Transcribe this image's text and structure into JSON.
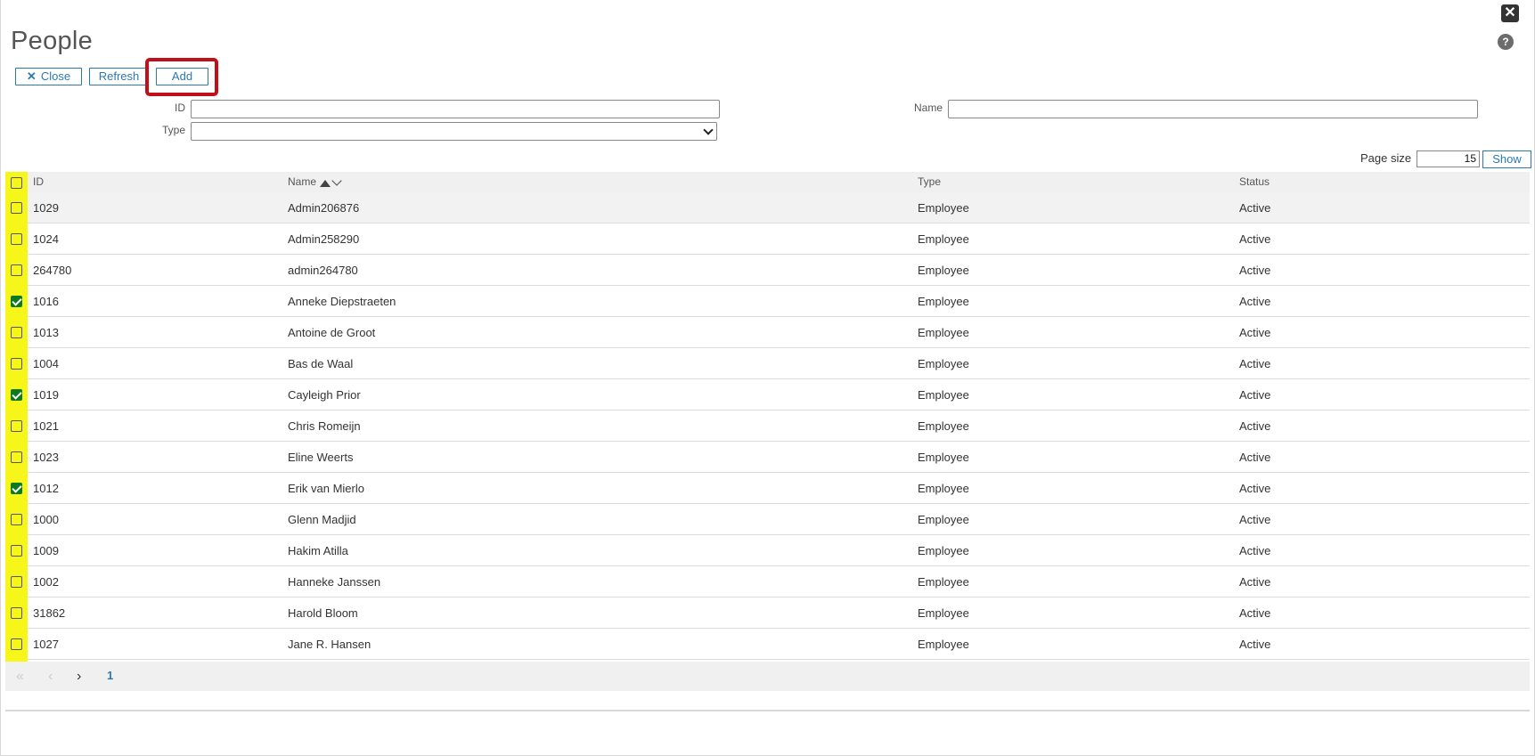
{
  "window": {
    "close_glyph": "✕",
    "help_glyph": "?"
  },
  "page": {
    "title": "People"
  },
  "toolbar": {
    "close_label": "Close",
    "close_icon": "✕",
    "refresh_label": "Refresh",
    "add_label": "Add"
  },
  "filters": {
    "id_label": "ID",
    "id_value": "",
    "name_label": "Name",
    "name_value": "",
    "type_label": "Type",
    "type_value": ""
  },
  "paging": {
    "page_size_label": "Page size",
    "page_size_value": "15",
    "show_label": "Show",
    "current_page": "1",
    "first_glyph": "«",
    "prev_glyph": "‹",
    "next_glyph": "›"
  },
  "grid": {
    "columns": [
      "ID",
      "Name",
      "Type",
      "Status"
    ],
    "sorted_column": "Name",
    "rows": [
      {
        "checked": false,
        "id": "1029",
        "name": "Admin206876",
        "type": "Employee",
        "status": "Active"
      },
      {
        "checked": false,
        "id": "1024",
        "name": "Admin258290",
        "type": "Employee",
        "status": "Active"
      },
      {
        "checked": false,
        "id": "264780",
        "name": "admin264780",
        "type": "Employee",
        "status": "Active"
      },
      {
        "checked": true,
        "id": "1016",
        "name": "Anneke Diepstraeten",
        "type": "Employee",
        "status": "Active"
      },
      {
        "checked": false,
        "id": "1013",
        "name": "Antoine de Groot",
        "type": "Employee",
        "status": "Active"
      },
      {
        "checked": false,
        "id": "1004",
        "name": "Bas de Waal",
        "type": "Employee",
        "status": "Active"
      },
      {
        "checked": true,
        "id": "1019",
        "name": "Cayleigh Prior",
        "type": "Employee",
        "status": "Active"
      },
      {
        "checked": false,
        "id": "1021",
        "name": "Chris Romeijn",
        "type": "Employee",
        "status": "Active"
      },
      {
        "checked": false,
        "id": "1023",
        "name": "Eline Weerts",
        "type": "Employee",
        "status": "Active"
      },
      {
        "checked": true,
        "id": "1012",
        "name": "Erik van Mierlo",
        "type": "Employee",
        "status": "Active"
      },
      {
        "checked": false,
        "id": "1000",
        "name": "Glenn Madjid",
        "type": "Employee",
        "status": "Active"
      },
      {
        "checked": false,
        "id": "1009",
        "name": "Hakim Atilla",
        "type": "Employee",
        "status": "Active"
      },
      {
        "checked": false,
        "id": "1002",
        "name": "Hanneke Janssen",
        "type": "Employee",
        "status": "Active"
      },
      {
        "checked": false,
        "id": "31862",
        "name": "Harold Bloom",
        "type": "Employee",
        "status": "Active"
      },
      {
        "checked": false,
        "id": "1027",
        "name": "Jane R. Hansen",
        "type": "Employee",
        "status": "Active"
      }
    ]
  },
  "colors": {
    "accent": "#2a7ab0",
    "highlight_strip": "#f6f61a",
    "add_highlight_border": "#c0101a",
    "checkbox_checked": "#0f7a1b"
  }
}
